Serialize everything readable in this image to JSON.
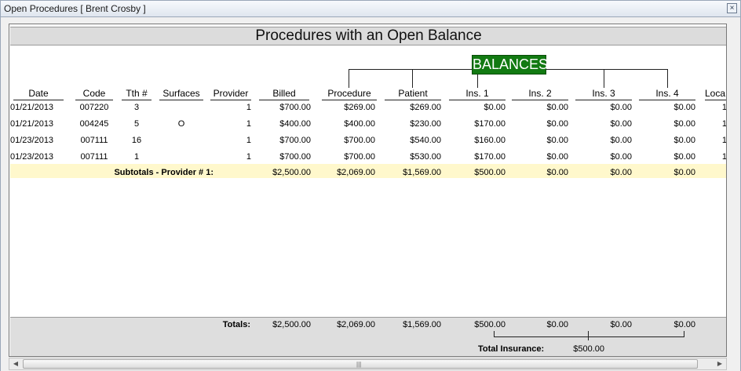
{
  "window": {
    "title": "Open Procedures [ Brent Crosby ]",
    "close_glyph": "×"
  },
  "report": {
    "title": "Procedures with an Open Balance",
    "balances_label": "BALANCES",
    "columns": {
      "date": "Date",
      "code": "Code",
      "tooth": "Tth #",
      "surfaces": "Surfaces",
      "provider": "Provider",
      "billed": "Billed",
      "procedure": "Procedure",
      "patient": "Patient",
      "ins1": "Ins. 1",
      "ins2": "Ins. 2",
      "ins3": "Ins. 3",
      "ins4": "Ins. 4",
      "location": "Loca"
    },
    "rows": [
      {
        "date": "01/21/2013",
        "code": "007220",
        "tooth": "3",
        "surfaces": "",
        "provider": "1",
        "billed": "$700.00",
        "procedure": "$269.00",
        "patient": "$269.00",
        "ins1": "$0.00",
        "ins2": "$0.00",
        "ins3": "$0.00",
        "ins4": "$0.00",
        "location": "1"
      },
      {
        "date": "01/21/2013",
        "code": "004245",
        "tooth": "5",
        "surfaces": "O",
        "provider": "1",
        "billed": "$400.00",
        "procedure": "$400.00",
        "patient": "$230.00",
        "ins1": "$170.00",
        "ins2": "$0.00",
        "ins3": "$0.00",
        "ins4": "$0.00",
        "location": "1"
      },
      {
        "date": "01/23/2013",
        "code": "007111",
        "tooth": "16",
        "surfaces": "",
        "provider": "1",
        "billed": "$700.00",
        "procedure": "$700.00",
        "patient": "$540.00",
        "ins1": "$160.00",
        "ins2": "$0.00",
        "ins3": "$0.00",
        "ins4": "$0.00",
        "location": "1"
      },
      {
        "date": "01/23/2013",
        "code": "007111",
        "tooth": "1",
        "surfaces": "",
        "provider": "1",
        "billed": "$700.00",
        "procedure": "$700.00",
        "patient": "$530.00",
        "ins1": "$170.00",
        "ins2": "$0.00",
        "ins3": "$0.00",
        "ins4": "$0.00",
        "location": "1"
      }
    ],
    "subtotal": {
      "label": "Subtotals - Provider # 1:",
      "billed": "$2,500.00",
      "procedure": "$2,069.00",
      "patient": "$1,569.00",
      "ins1": "$500.00",
      "ins2": "$0.00",
      "ins3": "$0.00",
      "ins4": "$0.00"
    },
    "totals": {
      "label": "Totals:",
      "billed": "$2,500.00",
      "procedure": "$2,069.00",
      "patient": "$1,569.00",
      "ins1": "$500.00",
      "ins2": "$0.00",
      "ins3": "$0.00",
      "ins4": "$0.00"
    },
    "total_insurance": {
      "label": "Total Insurance:",
      "value": "$500.00"
    }
  },
  "scrollbar": {
    "left_arrow": "◀",
    "right_arrow": "▶",
    "grip": "|||"
  }
}
